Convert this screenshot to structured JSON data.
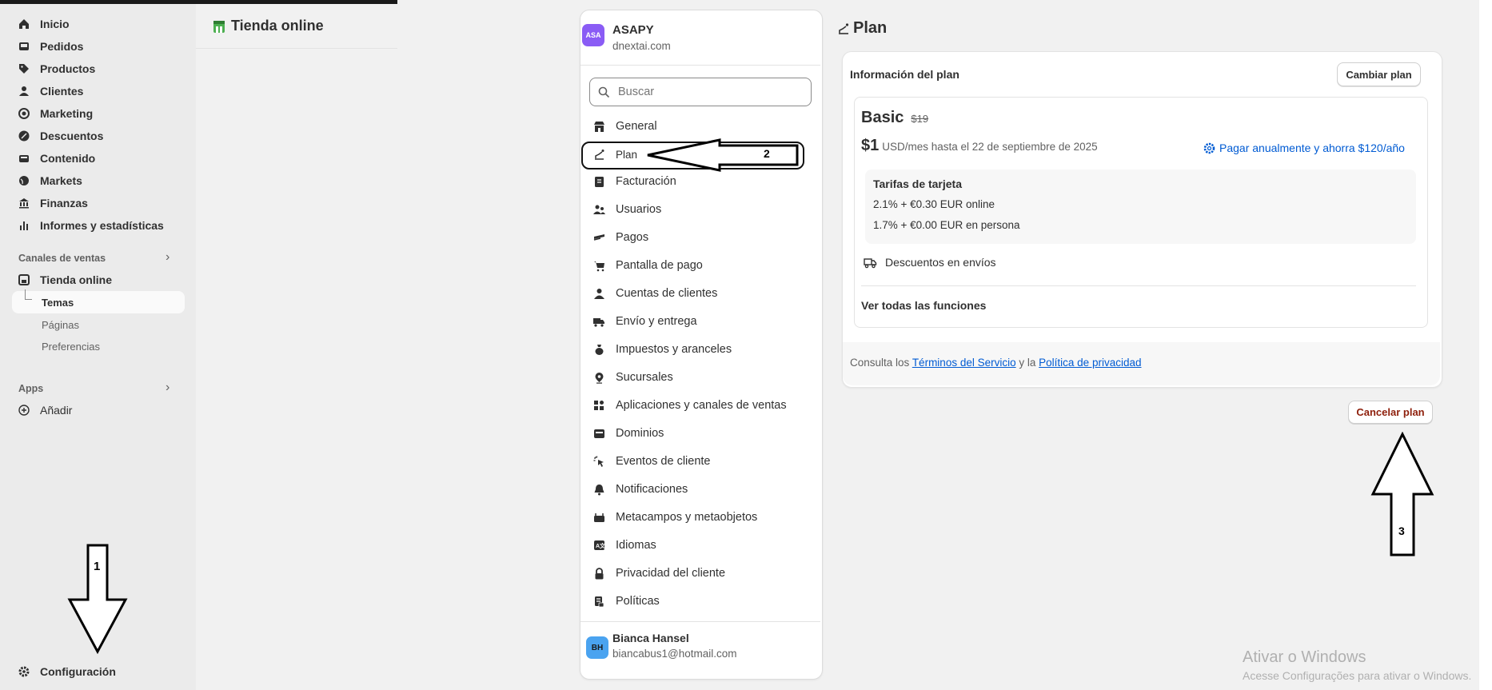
{
  "admin_nav": {
    "items": [
      {
        "label": "Inicio",
        "icon": "home-icon"
      },
      {
        "label": "Pedidos",
        "icon": "inbox-icon"
      },
      {
        "label": "Productos",
        "icon": "tag-icon"
      },
      {
        "label": "Clientes",
        "icon": "person-icon"
      },
      {
        "label": "Marketing",
        "icon": "target-icon"
      },
      {
        "label": "Descuentos",
        "icon": "discount-icon"
      },
      {
        "label": "Contenido",
        "icon": "content-icon"
      },
      {
        "label": "Markets",
        "icon": "globe-icon"
      },
      {
        "label": "Finanzas",
        "icon": "bank-icon"
      },
      {
        "label": "Informes y estadísticas",
        "icon": "bar-chart-icon"
      }
    ],
    "sales_channels_label": "Canales de ventas",
    "online_store_label": "Tienda online",
    "sub_items": [
      "Temas",
      "Páginas",
      "Preferencias"
    ],
    "apps_label": "Apps",
    "add_label": "Añadir",
    "settings_label": "Configuración"
  },
  "store_header": {
    "title": "Tienda online"
  },
  "settings_nav": {
    "store_avatar": "ASA",
    "store_name": "ASAPY",
    "store_domain": "dnextai.com",
    "search_placeholder": "Buscar",
    "items": [
      {
        "label": "General",
        "icon": "store-icon"
      },
      {
        "label": "Plan",
        "icon": "plan-chart-icon"
      },
      {
        "label": "Facturación",
        "icon": "receipt-icon"
      },
      {
        "label": "Usuarios",
        "icon": "users-icon"
      },
      {
        "label": "Pagos",
        "icon": "payments-icon"
      },
      {
        "label": "Pantalla de pago",
        "icon": "cart-icon"
      },
      {
        "label": "Cuentas de clientes",
        "icon": "person-icon"
      },
      {
        "label": "Envío y entrega",
        "icon": "truck-icon"
      },
      {
        "label": "Impuestos y aranceles",
        "icon": "tax-icon"
      },
      {
        "label": "Sucursales",
        "icon": "location-icon"
      },
      {
        "label": "Aplicaciones y canales de ventas",
        "icon": "apps-icon"
      },
      {
        "label": "Dominios",
        "icon": "domain-icon"
      },
      {
        "label": "Eventos de cliente",
        "icon": "cursor-icon"
      },
      {
        "label": "Notificaciones",
        "icon": "bell-icon"
      },
      {
        "label": "Metacampos y metaobjetos",
        "icon": "metafields-icon"
      },
      {
        "label": "Idiomas",
        "icon": "language-icon"
      },
      {
        "label": "Privacidad del cliente",
        "icon": "lock-icon"
      },
      {
        "label": "Políticas",
        "icon": "policy-icon"
      }
    ],
    "user_avatar": "BH",
    "user_name": "Bianca Hansel",
    "user_email": "biancabus1@hotmail.com"
  },
  "plan_page": {
    "title": "Plan",
    "card_title": "Información del plan",
    "change_button": "Cambiar plan",
    "plan_name": "Basic",
    "old_price": "$19",
    "price": "$1",
    "price_detail": "USD/mes hasta el 22 de septiembre de 2025",
    "annual_link": "Pagar anualmente y ahorra $120/año",
    "rates_title": "Tarifas de tarjeta",
    "rate_online": "2.1% + €0.30 EUR online",
    "rate_in_person": "1.7% + €0.00 EUR en persona",
    "shipping_discounts": "Descuentos en envíos",
    "see_all": "Ver todas las funciones",
    "terms_prefix": "Consulta los",
    "terms_link": "Términos del Servicio",
    "terms_and": "y la",
    "privacy_link": "Política de privacidad",
    "cancel_button": "Cancelar plan"
  },
  "annotations": {
    "arrow1": "1",
    "arrow2": "2",
    "arrow3": "3"
  },
  "watermark": {
    "line1": "Ativar o Windows",
    "line2": "Acesse Configurações para ativar o Windows."
  },
  "colors": {
    "accent": "#005bd3",
    "danger": "#8e1f0b",
    "avatar_store": "#8a5cf5",
    "avatar_user": "#4aa3f0"
  }
}
